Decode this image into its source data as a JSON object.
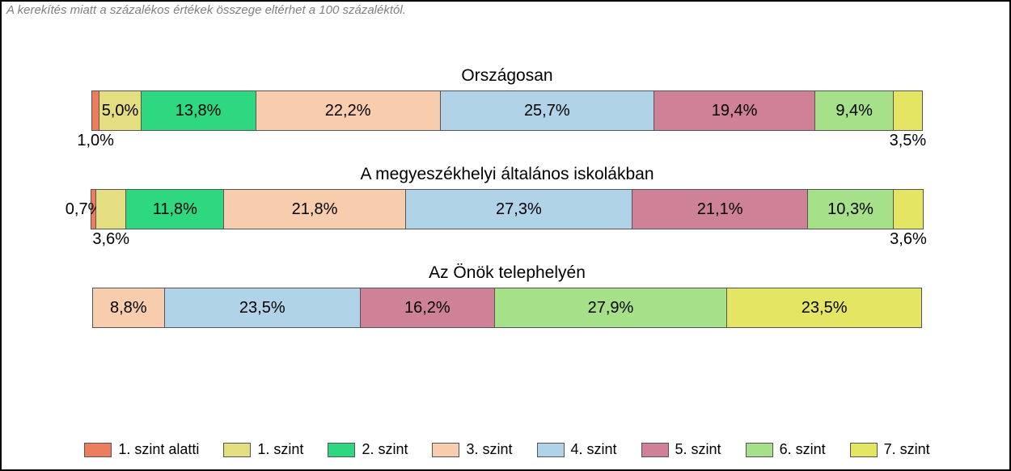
{
  "disclaimer": "A kerekítés miatt a százalékos értékek összege eltérhet a 100 százaléktól.",
  "groups": [
    {
      "title": "Országosan",
      "segments": [
        {
          "value": 1.0,
          "label": "1,0%",
          "labelPos": "below"
        },
        {
          "value": 5.0,
          "label": "5,0%",
          "labelPos": "in"
        },
        {
          "value": 13.8,
          "label": "13,8%",
          "labelPos": "in"
        },
        {
          "value": 22.2,
          "label": "22,2%",
          "labelPos": "in"
        },
        {
          "value": 25.7,
          "label": "25,7%",
          "labelPos": "in"
        },
        {
          "value": 19.4,
          "label": "19,4%",
          "labelPos": "in"
        },
        {
          "value": 9.4,
          "label": "9,4%",
          "labelPos": "in"
        },
        {
          "value": 3.5,
          "label": "3,5%",
          "labelPos": "below"
        }
      ]
    },
    {
      "title": "A megyeszékhelyi általános iskolákban",
      "segments": [
        {
          "value": 0.7,
          "label": "0,7%",
          "labelPos": "in",
          "shift": -12
        },
        {
          "value": 3.6,
          "label": "3,6%",
          "labelPos": "below"
        },
        {
          "value": 11.8,
          "label": "11,8%",
          "labelPos": "in"
        },
        {
          "value": 21.8,
          "label": "21,8%",
          "labelPos": "in"
        },
        {
          "value": 27.3,
          "label": "27,3%",
          "labelPos": "in"
        },
        {
          "value": 21.1,
          "label": "21,1%",
          "labelPos": "in"
        },
        {
          "value": 10.3,
          "label": "10,3%",
          "labelPos": "in"
        },
        {
          "value": 3.6,
          "label": "3,6%",
          "labelPos": "below"
        }
      ]
    },
    {
      "title": "Az Önök telephelyén",
      "segments": [
        {
          "value": 0.0,
          "label": "",
          "labelPos": "none"
        },
        {
          "value": 0.0,
          "label": "",
          "labelPos": "none"
        },
        {
          "value": 0.0,
          "label": "",
          "labelPos": "none"
        },
        {
          "value": 8.8,
          "label": "8,8%",
          "labelPos": "in"
        },
        {
          "value": 23.5,
          "label": "23,5%",
          "labelPos": "in"
        },
        {
          "value": 16.2,
          "label": "16,2%",
          "labelPos": "in"
        },
        {
          "value": 27.9,
          "label": "27,9%",
          "labelPos": "in"
        },
        {
          "value": 23.5,
          "label": "23,5%",
          "labelPos": "in"
        }
      ]
    }
  ],
  "legend": [
    "1. szint alatti",
    "1. szint",
    "2. szint",
    "3. szint",
    "4. szint",
    "5. szint",
    "6. szint",
    "7. szint"
  ],
  "chart_data": {
    "type": "bar",
    "stacked": true,
    "orientation": "horizontal",
    "unit": "percent",
    "categories": [
      "Országosan",
      "A megyeszékhelyi általános iskolákban",
      "Az Önök telephelyén"
    ],
    "series": [
      {
        "name": "1. szint alatti",
        "values": [
          1.0,
          0.7,
          0.0
        ]
      },
      {
        "name": "1. szint",
        "values": [
          5.0,
          3.6,
          0.0
        ]
      },
      {
        "name": "2. szint",
        "values": [
          13.8,
          11.8,
          0.0
        ]
      },
      {
        "name": "3. szint",
        "values": [
          22.2,
          21.8,
          8.8
        ]
      },
      {
        "name": "4. szint",
        "values": [
          25.7,
          27.3,
          23.5
        ]
      },
      {
        "name": "5. szint",
        "values": [
          19.4,
          21.1,
          16.2
        ]
      },
      {
        "name": "6. szint",
        "values": [
          9.4,
          10.3,
          27.9
        ]
      },
      {
        "name": "7. szint",
        "values": [
          3.5,
          3.6,
          23.5
        ]
      }
    ],
    "title": "",
    "xlabel": "",
    "ylabel": "",
    "xlim": [
      0,
      100
    ]
  }
}
